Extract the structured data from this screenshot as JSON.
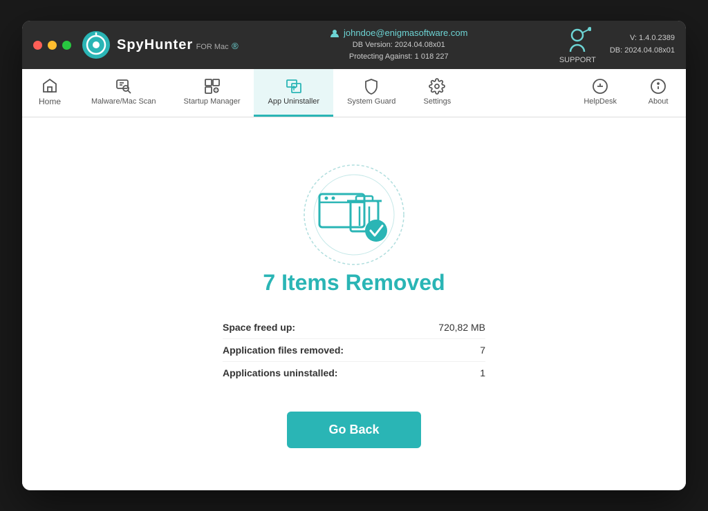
{
  "window": {
    "title": "SpyHunter for Mac"
  },
  "titlebar": {
    "user_email": "johndoe@enigmasoftware.com",
    "db_version_label": "DB Version: 2024.04.08x01",
    "protecting_label": "Protecting Against: 1 018 227",
    "support_label": "SUPPORT",
    "version_line1": "V: 1.4.0.2389",
    "version_line2": "DB:  2024.04.08x01"
  },
  "navbar": {
    "items": [
      {
        "id": "home",
        "label": "Home",
        "icon": "🏠",
        "active": false
      },
      {
        "id": "malware-scan",
        "label": "Malware/Mac Scan",
        "icon": "🔍",
        "active": false
      },
      {
        "id": "startup-manager",
        "label": "Startup Manager",
        "icon": "⊞",
        "active": false
      },
      {
        "id": "app-uninstaller",
        "label": "App Uninstaller",
        "icon": "🗑",
        "active": true
      },
      {
        "id": "system-guard",
        "label": "System Guard",
        "icon": "🛡",
        "active": false
      },
      {
        "id": "settings",
        "label": "Settings",
        "icon": "⚙",
        "active": false
      }
    ],
    "right_items": [
      {
        "id": "helpdesk",
        "label": "HelpDesk",
        "icon": "⊕"
      },
      {
        "id": "about",
        "label": "About",
        "icon": "ℹ"
      }
    ]
  },
  "main": {
    "result_title": "7 Items Removed",
    "stats": [
      {
        "label": "Space freed up:",
        "value": "720,82 MB"
      },
      {
        "label": "Application files removed:",
        "value": "7"
      },
      {
        "label": "Applications uninstalled:",
        "value": "1"
      }
    ],
    "go_back_button": "Go Back"
  }
}
